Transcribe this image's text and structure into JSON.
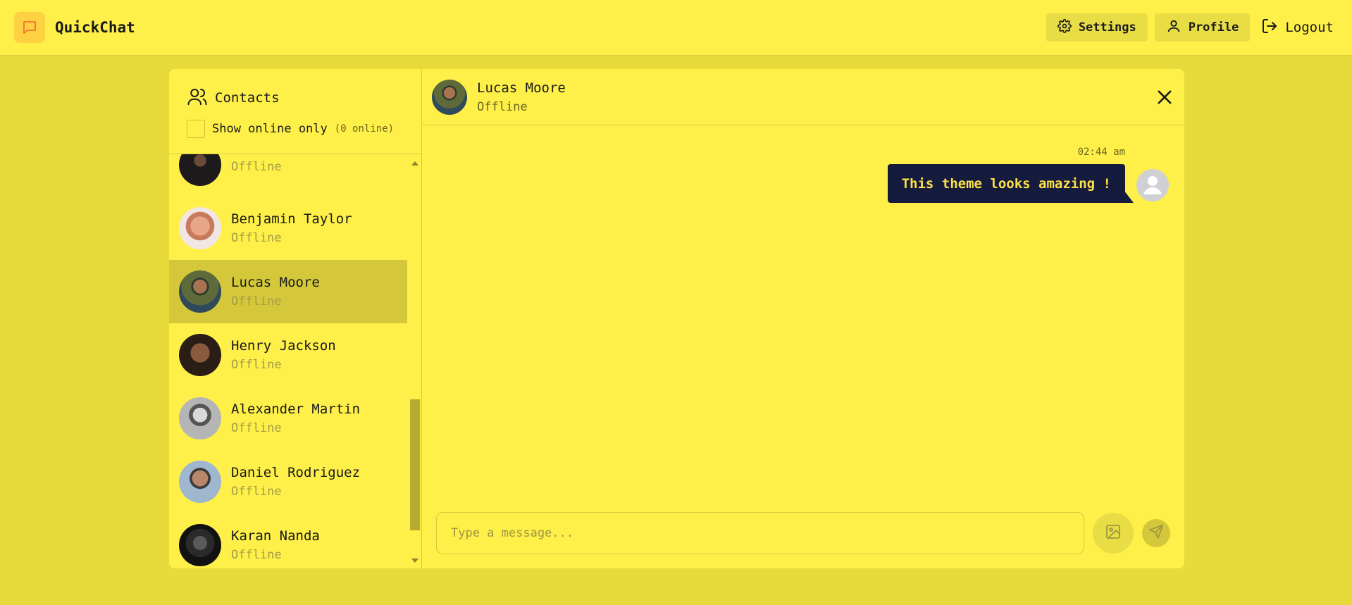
{
  "app": {
    "name": "QuickChat"
  },
  "nav": {
    "settings": "Settings",
    "profile": "Profile",
    "logout": "Logout"
  },
  "sidebar": {
    "title": "Contacts",
    "filter_label": "Show online only",
    "online_count": "(0 online)",
    "contacts": [
      {
        "name": "",
        "status": "Offline"
      },
      {
        "name": "Benjamin Taylor",
        "status": "Offline"
      },
      {
        "name": "Lucas Moore",
        "status": "Offline"
      },
      {
        "name": "Henry Jackson",
        "status": "Offline"
      },
      {
        "name": "Alexander Martin",
        "status": "Offline"
      },
      {
        "name": "Daniel Rodriguez",
        "status": "Offline"
      },
      {
        "name": "Karan Nanda",
        "status": "Offline"
      }
    ]
  },
  "chat": {
    "name": "Lucas Moore",
    "status": "Offline",
    "messages": [
      {
        "time": "02:44 am",
        "text": "This theme looks amazing !"
      }
    ],
    "input_placeholder": "Type a message..."
  },
  "colors": {
    "background": "#e6db3a",
    "panel": "#fef049",
    "active": "#d4c83a",
    "bubble": "#141b3d"
  }
}
